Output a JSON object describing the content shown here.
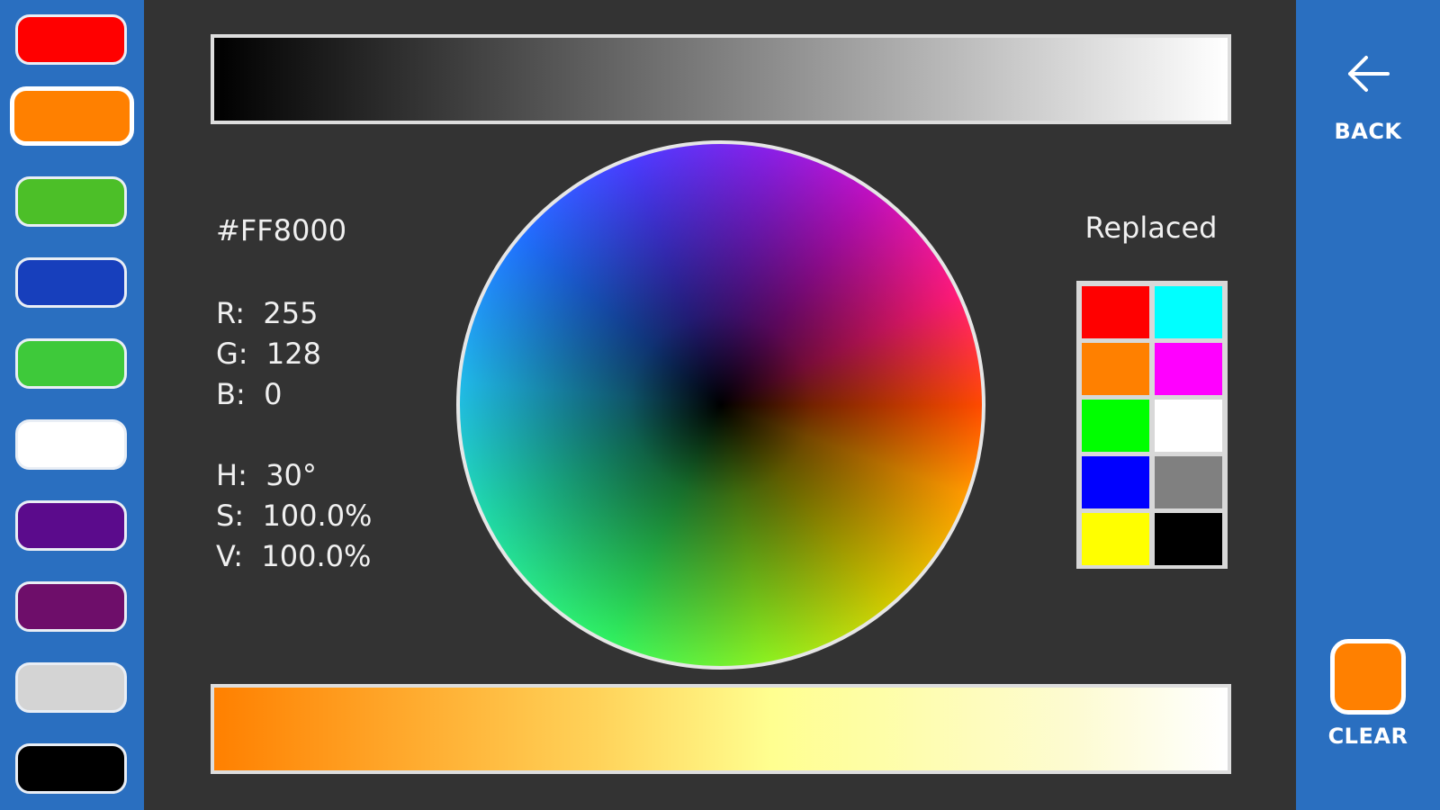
{
  "palette": {
    "swatches": [
      {
        "color": "#ff0000",
        "selected": false
      },
      {
        "color": "#ff8000",
        "selected": true
      },
      {
        "color": "#4cbf28",
        "selected": false
      },
      {
        "color": "#173fbc",
        "selected": false
      },
      {
        "color": "#3ec93a",
        "selected": false
      },
      {
        "color": "#ffffff",
        "selected": false
      },
      {
        "color": "#5b0b8c",
        "selected": false
      },
      {
        "color": "#6e0e6a",
        "selected": false
      },
      {
        "color": "#d4d4d4",
        "selected": false
      },
      {
        "color": "#000000",
        "selected": false
      }
    ]
  },
  "color_info": {
    "hex": "#FF8000",
    "r_label": "R:",
    "r": "255",
    "g_label": "G:",
    "g": "128",
    "b_label": "B:",
    "b": "0",
    "h_label": "H:",
    "h": "30°",
    "s_label": "S:",
    "s": "100.0%",
    "v_label": "V:",
    "v": "100.0%"
  },
  "replaced": {
    "title": "Replaced",
    "colors": [
      "#ff0000",
      "#00ffff",
      "#ff8000",
      "#ff00ff",
      "#00ff00",
      "#ffffff",
      "#0000ff",
      "#808080",
      "#ffff00",
      "#000000"
    ]
  },
  "actions": {
    "back_label": "BACK",
    "clear_label": "CLEAR",
    "clear_color": "#ff8000"
  },
  "icons": {
    "back": "arrow-left-icon"
  }
}
